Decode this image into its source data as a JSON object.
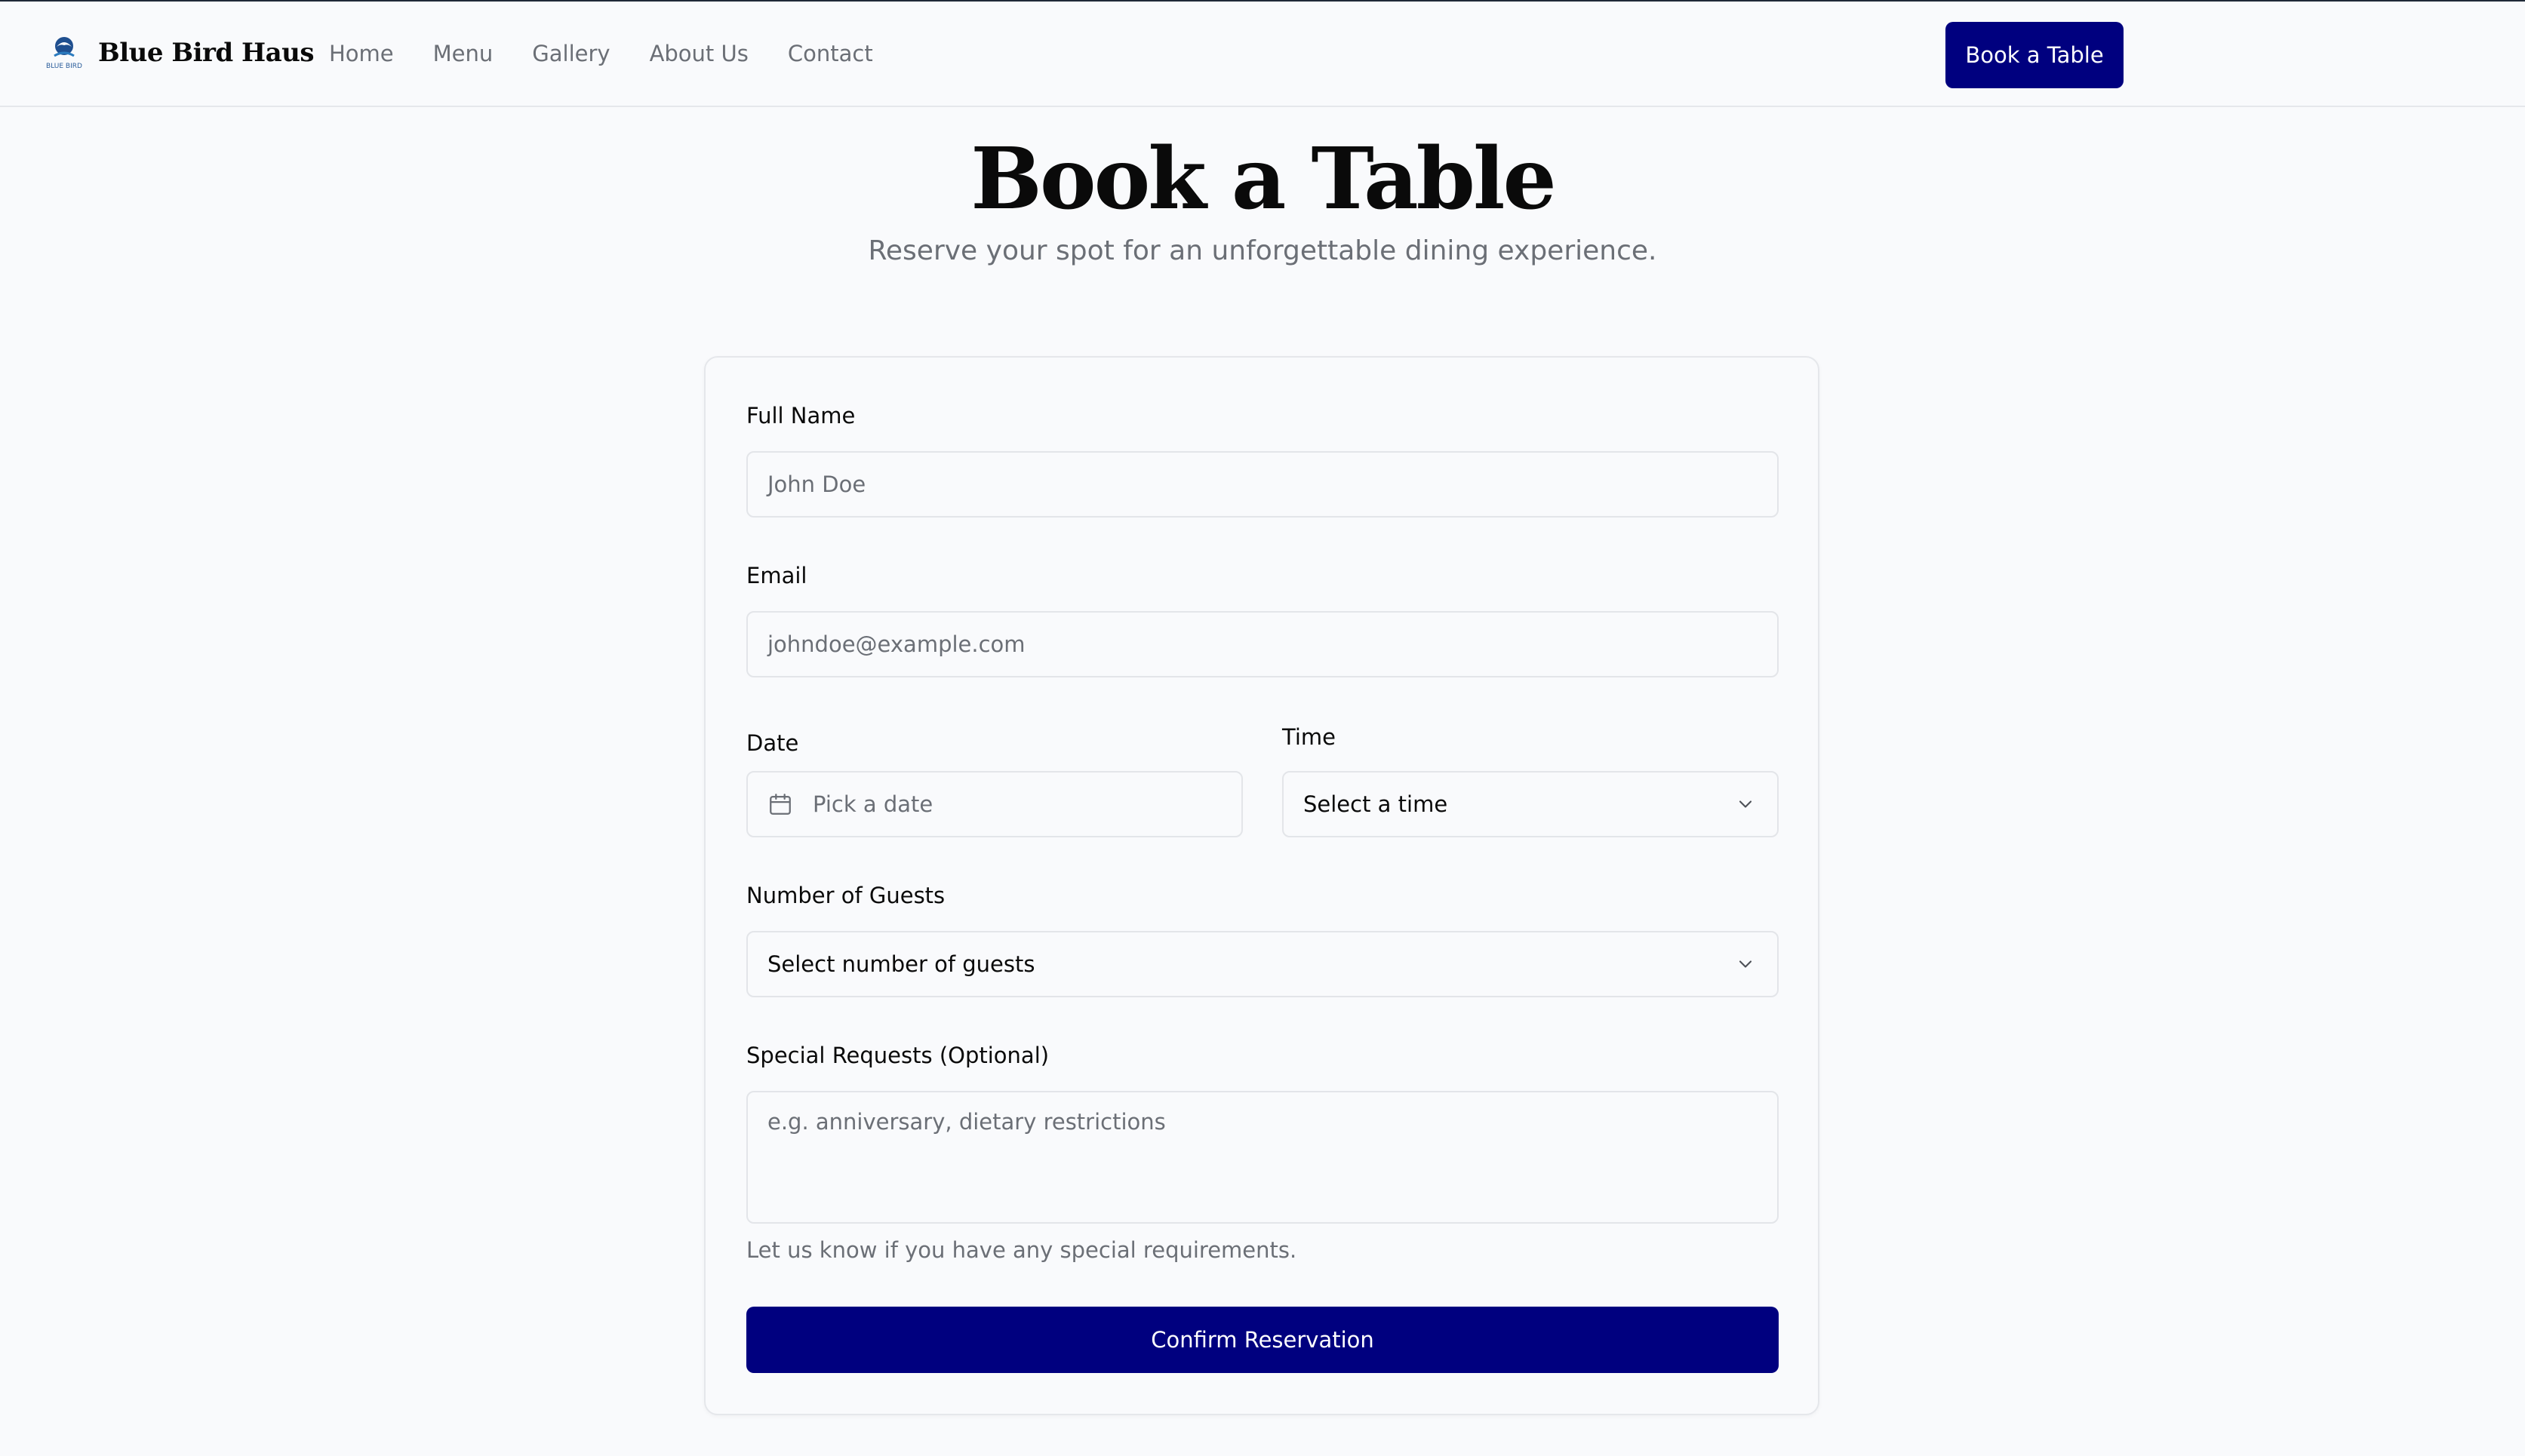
{
  "header": {
    "brand_name": "Blue Bird Haus",
    "logo_text": "BLUE BIRD",
    "nav": [
      {
        "label": "Home"
      },
      {
        "label": "Menu"
      },
      {
        "label": "Gallery"
      },
      {
        "label": "About Us"
      },
      {
        "label": "Contact"
      }
    ],
    "cta_label": "Book a Table"
  },
  "hero": {
    "title": "Book a Table",
    "subtitle": "Reserve your spot for an unforgettable dining experience."
  },
  "form": {
    "full_name": {
      "label": "Full Name",
      "placeholder": "John Doe"
    },
    "email": {
      "label": "Email",
      "placeholder": "johndoe@example.com"
    },
    "date": {
      "label": "Date",
      "placeholder": "Pick a date",
      "icon": "calendar-icon"
    },
    "time": {
      "label": "Time",
      "value": "Select a time",
      "icon": "chevron-down-icon"
    },
    "guests": {
      "label": "Number of Guests",
      "value": "Select number of guests",
      "icon": "chevron-down-icon"
    },
    "requests": {
      "label": "Special Requests (Optional)",
      "placeholder": "e.g. anniversary, dietary restrictions",
      "helper": "Let us know if you have any special requirements."
    },
    "submit_label": "Confirm Reservation"
  },
  "colors": {
    "primary": "#00007f",
    "background": "#f9fafc",
    "muted_text": "#6b6f76",
    "border": "#e3e5e9"
  }
}
